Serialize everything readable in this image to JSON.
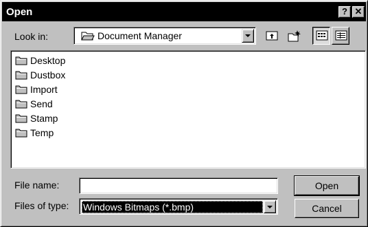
{
  "window": {
    "title": "Open",
    "help_label": "?",
    "close_label": "✕"
  },
  "look_in": {
    "label": "Look in:",
    "value": "Document Manager",
    "icon": "open-folder-icon"
  },
  "toolbar": {
    "up_icon": "up-one-level-icon",
    "new_folder_icon": "new-folder-icon",
    "list_view_icon": "list-view-icon",
    "details_view_icon": "details-view-icon",
    "active_view": "list"
  },
  "files": [
    {
      "name": "Desktop",
      "icon": "folder-icon"
    },
    {
      "name": "Dustbox",
      "icon": "folder-icon"
    },
    {
      "name": "Import",
      "icon": "folder-icon"
    },
    {
      "name": "Send",
      "icon": "folder-icon"
    },
    {
      "name": "Stamp",
      "icon": "folder-icon"
    },
    {
      "name": "Temp",
      "icon": "folder-icon"
    }
  ],
  "file_name": {
    "label": "File name:",
    "value": ""
  },
  "file_type": {
    "label": "Files of type:",
    "value": "Windows Bitmaps (*.bmp)"
  },
  "buttons": {
    "open": "Open",
    "cancel": "Cancel"
  },
  "colors": {
    "face": "#c0c0c0",
    "titlebar": "#000000",
    "selection": "#000000"
  }
}
